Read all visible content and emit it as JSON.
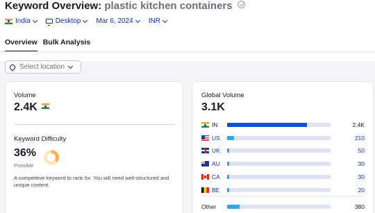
{
  "header": {
    "title_prefix": "Keyword Overview:",
    "keyword": "plastic kitchen containers",
    "filters": [
      {
        "label": "India",
        "icon": "flag-in"
      },
      {
        "label": "Desktop",
        "icon": "desktop-icon"
      },
      {
        "label": "Mar 6, 2024"
      },
      {
        "label": "INR"
      }
    ],
    "tabs": [
      {
        "label": "Overview",
        "active": true
      },
      {
        "label": "Bulk Analysis",
        "active": false
      }
    ]
  },
  "location_select": {
    "placeholder": "Select location"
  },
  "volume": {
    "label": "Volume",
    "value": "2.4K",
    "flag": "flag-in"
  },
  "keyword_difficulty": {
    "label": "Keyword Difficulty",
    "value": "36%",
    "rating": "Possible",
    "percent": 36,
    "description": "A competitive keyword to rank for. You will need well-structured and unique content.",
    "colors": {
      "fill": "#ffb04c",
      "track": "#ffe4bd"
    }
  },
  "global_volume": {
    "label": "Global Volume",
    "value": "3.1K",
    "rows": [
      {
        "code": "IN",
        "flag": "flag-in",
        "value": "2.4K",
        "fraction": 0.77
      },
      {
        "code": "US",
        "flag": "flag-us",
        "value": "210",
        "fraction": 0.07
      },
      {
        "code": "UK",
        "flag": "flag-uk",
        "value": "50",
        "fraction": 0.02
      },
      {
        "code": "AU",
        "flag": "flag-au",
        "value": "30",
        "fraction": 0.012
      },
      {
        "code": "CA",
        "flag": "flag-ca",
        "value": "30",
        "fraction": 0.012
      },
      {
        "code": "BE",
        "flag": "flag-be",
        "value": "20",
        "fraction": 0.008
      }
    ],
    "other": {
      "label": "Other",
      "value": "380",
      "fraction": 0.12
    },
    "colors": {
      "primary": "#0d52d6",
      "secondary": "#2fa7f0",
      "track": "#dfe3f1"
    }
  }
}
